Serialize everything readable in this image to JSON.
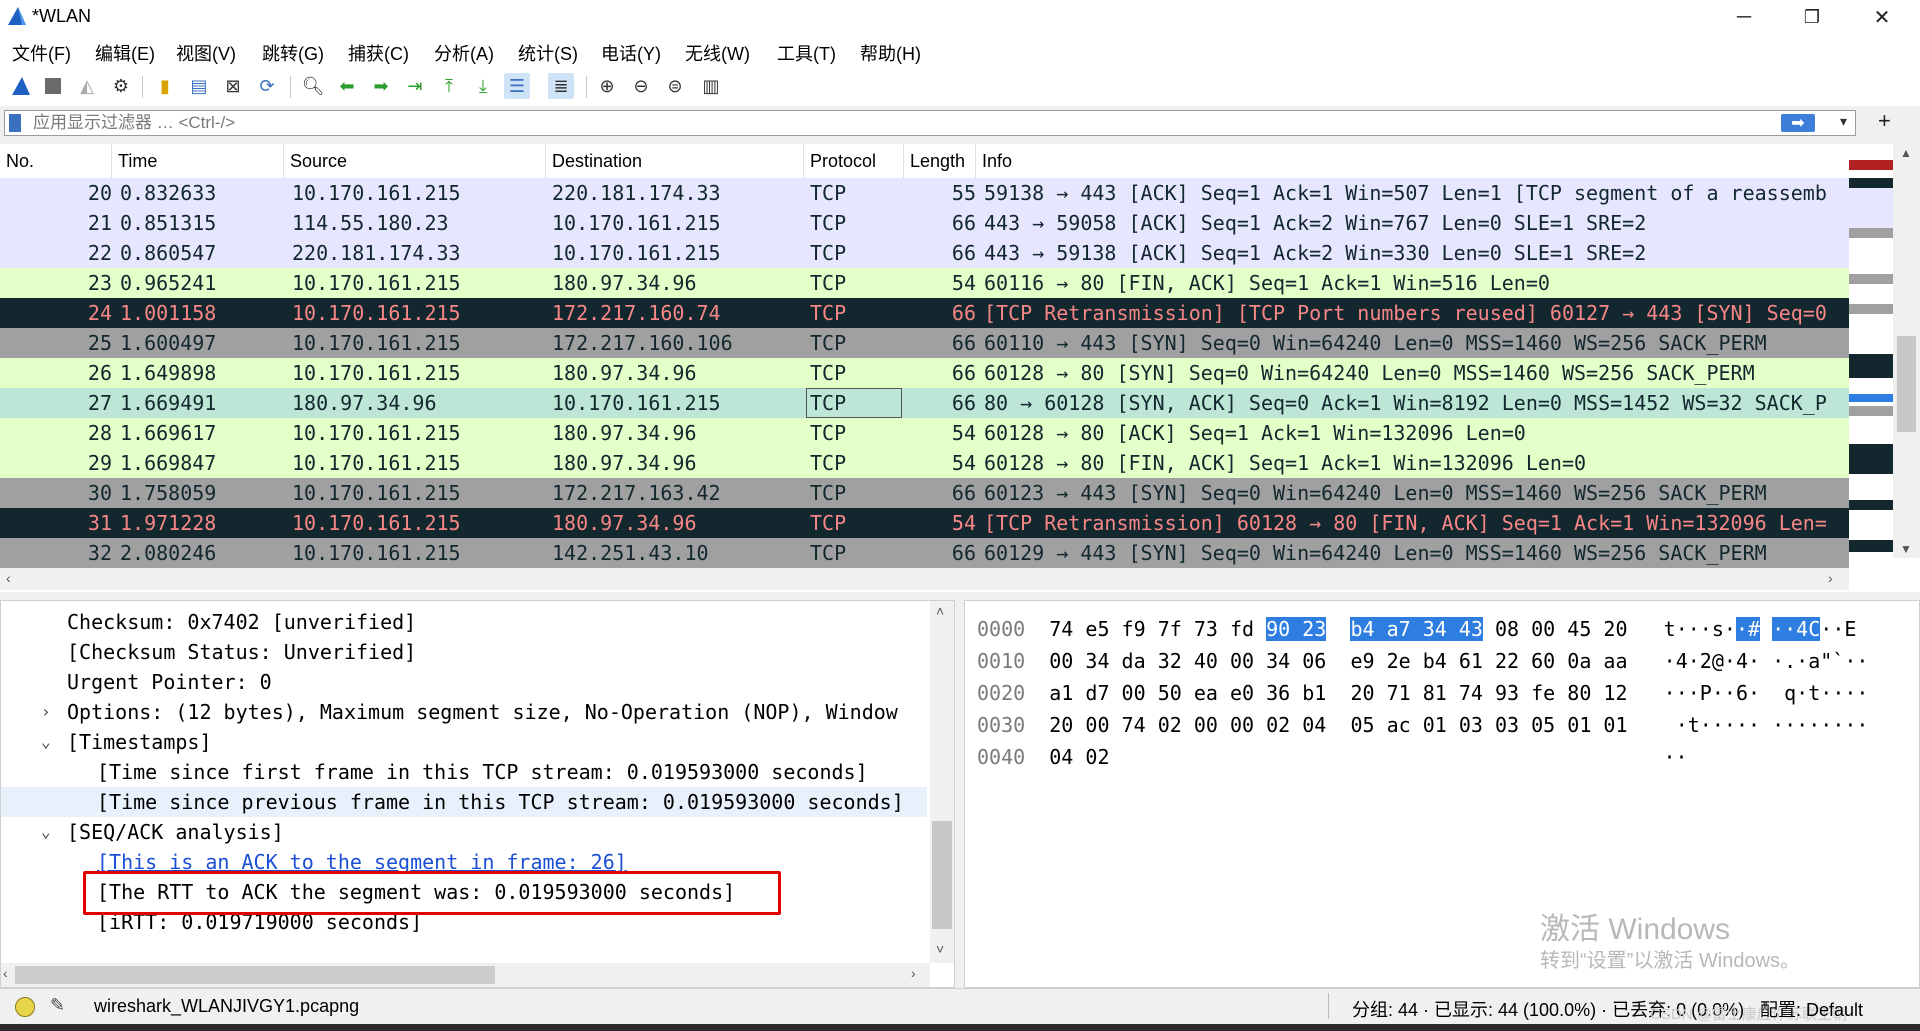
{
  "window": {
    "title": "*WLAN",
    "minimize": "─",
    "maximize": "❐",
    "close": "✕"
  },
  "menu": [
    "文件(F)",
    "编辑(E)",
    "视图(V)",
    "跳转(G)",
    "捕获(C)",
    "分析(A)",
    "统计(S)",
    "电话(Y)",
    "无线(W)",
    "工具(T)",
    "帮助(H)"
  ],
  "filter": {
    "placeholder": "应用显示过滤器 … <Ctrl-/>",
    "apply": "➡",
    "dropdown": "▾",
    "add": "+"
  },
  "packet_list": {
    "columns": [
      "No.",
      "Time",
      "Source",
      "Destination",
      "Protocol",
      "Length",
      "Info"
    ],
    "rows": [
      {
        "no": "20",
        "time": "0.832633",
        "src": "10.170.161.215",
        "dst": "220.181.174.33",
        "proto": "TCP",
        "len": "55",
        "info": "59138 → 443 [ACK] Seq=1 Ack=1 Win=507 Len=1 [TCP segment of a reassemb",
        "bg": "#e7e6ff",
        "fg": "#12272e"
      },
      {
        "no": "21",
        "time": "0.851315",
        "src": "114.55.180.23",
        "dst": "10.170.161.215",
        "proto": "TCP",
        "len": "66",
        "info": "443 → 59058 [ACK] Seq=1 Ack=2 Win=767 Len=0 SLE=1 SRE=2",
        "bg": "#e7e6ff",
        "fg": "#12272e"
      },
      {
        "no": "22",
        "time": "0.860547",
        "src": "220.181.174.33",
        "dst": "10.170.161.215",
        "proto": "TCP",
        "len": "66",
        "info": "443 → 59138 [ACK] Seq=1 Ack=2 Win=330 Len=0 SLE=1 SRE=2",
        "bg": "#e7e6ff",
        "fg": "#12272e"
      },
      {
        "no": "23",
        "time": "0.965241",
        "src": "10.170.161.215",
        "dst": "180.97.34.96",
        "proto": "TCP",
        "len": "54",
        "info": "60116 → 80 [FIN, ACK] Seq=1 Ack=1 Win=516 Len=0",
        "bg": "#e4ffc7",
        "fg": "#12272e"
      },
      {
        "no": "24",
        "time": "1.001158",
        "src": "10.170.161.215",
        "dst": "172.217.160.74",
        "proto": "TCP",
        "len": "66",
        "info": "[TCP Retransmission] [TCP Port numbers reused] 60127 → 443 [SYN] Seq=0",
        "bg": "#12272e",
        "fg": "#f78787"
      },
      {
        "no": "25",
        "time": "1.600497",
        "src": "10.170.161.215",
        "dst": "172.217.160.106",
        "proto": "TCP",
        "len": "66",
        "info": "60110 → 443 [SYN] Seq=0 Win=64240 Len=0 MSS=1460 WS=256 SACK_PERM",
        "bg": "#a0a0a0",
        "fg": "#12272e"
      },
      {
        "no": "26",
        "time": "1.649898",
        "src": "10.170.161.215",
        "dst": "180.97.34.96",
        "proto": "TCP",
        "len": "66",
        "info": "60128 → 80 [SYN] Seq=0 Win=64240 Len=0 MSS=1460 WS=256 SACK_PERM",
        "bg": "#e4ffc7",
        "fg": "#12272e"
      },
      {
        "no": "27",
        "time": "1.669491",
        "src": "180.97.34.96",
        "dst": "10.170.161.215",
        "proto": "TCP",
        "len": "66",
        "info": "80 → 60128 [SYN, ACK] Seq=0 Ack=1 Win=8192 Len=0 MSS=1452 WS=32 SACK_P",
        "bg": "#bde6d6",
        "fg": "#12272e",
        "selected": true
      },
      {
        "no": "28",
        "time": "1.669617",
        "src": "10.170.161.215",
        "dst": "180.97.34.96",
        "proto": "TCP",
        "len": "54",
        "info": "60128 → 80 [ACK] Seq=1 Ack=1 Win=132096 Len=0",
        "bg": "#e4ffc7",
        "fg": "#12272e"
      },
      {
        "no": "29",
        "time": "1.669847",
        "src": "10.170.161.215",
        "dst": "180.97.34.96",
        "proto": "TCP",
        "len": "54",
        "info": "60128 → 80 [FIN, ACK] Seq=1 Ack=1 Win=132096 Len=0",
        "bg": "#e4ffc7",
        "fg": "#12272e"
      },
      {
        "no": "30",
        "time": "1.758059",
        "src": "10.170.161.215",
        "dst": "172.217.163.42",
        "proto": "TCP",
        "len": "66",
        "info": "60123 → 443 [SYN] Seq=0 Win=64240 Len=0 MSS=1460 WS=256 SACK_PERM",
        "bg": "#a0a0a0",
        "fg": "#12272e"
      },
      {
        "no": "31",
        "time": "1.971228",
        "src": "10.170.161.215",
        "dst": "180.97.34.96",
        "proto": "TCP",
        "len": "54",
        "info": "[TCP Retransmission] 60128 → 80 [FIN, ACK] Seq=1 Ack=1 Win=132096 Len=",
        "bg": "#12272e",
        "fg": "#f78787"
      },
      {
        "no": "32",
        "time": "2.080246",
        "src": "10.170.161.215",
        "dst": "142.251.43.10",
        "proto": "TCP",
        "len": "66",
        "info": "60129 → 443 [SYN] Seq=0 Win=64240 Len=0 MSS=1460 WS=256 SACK_PERM",
        "bg": "#a0a0a0",
        "fg": "#12272e"
      }
    ]
  },
  "detail": {
    "lines": [
      {
        "text": "Checksum: 0x7402 [unverified]",
        "indent": 1
      },
      {
        "text": "[Checksum Status: Unverified]",
        "indent": 1
      },
      {
        "text": "Urgent Pointer: 0",
        "indent": 1
      },
      {
        "text": "Options: (12 bytes), Maximum segment size, No-Operation (NOP), Window",
        "indent": 1,
        "arrow": "›"
      },
      {
        "text": "[Timestamps]",
        "indent": 1,
        "arrow": "⌄"
      },
      {
        "text": "[Time since first frame in this TCP stream: 0.019593000 seconds]",
        "indent": 2
      },
      {
        "text": "[Time since previous frame in this TCP stream: 0.019593000 seconds]",
        "indent": 2,
        "selected": true
      },
      {
        "text": "[SEQ/ACK analysis]",
        "indent": 1,
        "arrow": "⌄"
      },
      {
        "text": "[This is an ACK to the segment in frame: 26]",
        "indent": 2,
        "link": true
      },
      {
        "text": "[The RTT to ACK the segment was: 0.019593000 seconds]",
        "indent": 2
      },
      {
        "text": "[iRTT: 0.019719000 seconds]",
        "indent": 2
      }
    ]
  },
  "bytes": {
    "lines": [
      {
        "offset": "0000",
        "hex": [
          "74",
          "e5",
          "f9",
          "7f",
          "73",
          "fd",
          "90",
          "23",
          "b4",
          "a7",
          "34",
          "43",
          "08",
          "00",
          "45",
          "20"
        ],
        "ascii": [
          "t",
          "·",
          "·",
          "·",
          "s",
          "·",
          "·",
          "#",
          "·",
          "·",
          "4",
          "C",
          "·",
          "·",
          "E",
          " "
        ],
        "hl": [
          6,
          7,
          8,
          9,
          10,
          11
        ]
      },
      {
        "offset": "0010",
        "hex": [
          "00",
          "34",
          "da",
          "32",
          "40",
          "00",
          "34",
          "06",
          "e9",
          "2e",
          "b4",
          "61",
          "22",
          "60",
          "0a",
          "aa"
        ],
        "ascii": [
          "·",
          "4",
          "·",
          "2",
          "@",
          "·",
          "4",
          "·",
          "·",
          ".",
          "·",
          "a",
          "\"",
          "`",
          "·",
          "·"
        ],
        "hl": []
      },
      {
        "offset": "0020",
        "hex": [
          "a1",
          "d7",
          "00",
          "50",
          "ea",
          "e0",
          "36",
          "b1",
          "20",
          "71",
          "81",
          "74",
          "93",
          "fe",
          "80",
          "12"
        ],
        "ascii": [
          "·",
          "·",
          "·",
          "P",
          "·",
          "·",
          "6",
          "·",
          " ",
          "q",
          "·",
          "t",
          "·",
          "·",
          "·",
          "·"
        ],
        "hl": []
      },
      {
        "offset": "0030",
        "hex": [
          "20",
          "00",
          "74",
          "02",
          "00",
          "00",
          "02",
          "04",
          "05",
          "ac",
          "01",
          "03",
          "03",
          "05",
          "01",
          "01"
        ],
        "ascii": [
          " ",
          "·",
          "t",
          "·",
          "·",
          "·",
          "·",
          "·",
          "·",
          "·",
          "·",
          "·",
          "·",
          "·",
          "·",
          "·"
        ],
        "hl": []
      },
      {
        "offset": "0040",
        "hex": [
          "04",
          "02"
        ],
        "ascii": [
          "·",
          "·"
        ],
        "hl": []
      }
    ]
  },
  "watermark": {
    "line1": "激活 Windows",
    "line2": "转到“设置”以激活 Windows。"
  },
  "status": {
    "file": "wireshark_WLANJIVGY1.pcapng",
    "stats": "分组: 44 · 已显示: 44 (100.0%) · 已丢弃: 0 (0.0%)",
    "profile": "配置: Default",
    "csdn": "CSDN @雷士康应你苏联王朝"
  },
  "colors": {
    "selection_blue": "#2e7de0",
    "highlight_red": "#e00000",
    "retrans_fg": "#f78787",
    "retrans_bg": "#12272e"
  }
}
